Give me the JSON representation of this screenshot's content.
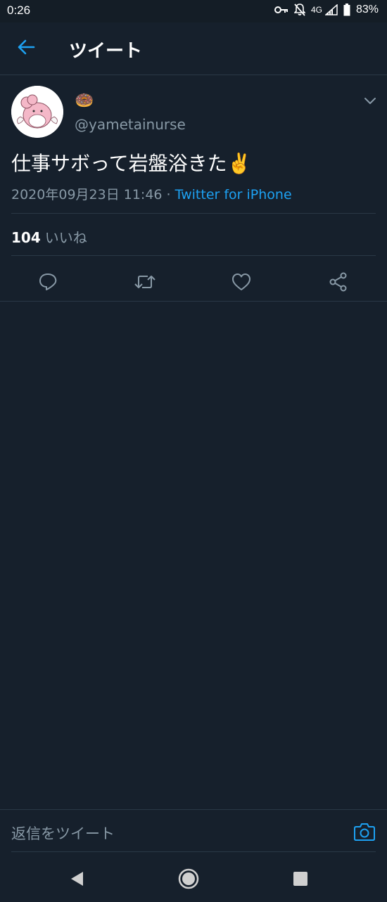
{
  "status_bar": {
    "time": "0:26",
    "network": "4G",
    "battery": "83%"
  },
  "header": {
    "title": "ツイート"
  },
  "tweet": {
    "display_name": "🍩",
    "handle": "@yametainurse",
    "text": "仕事サボって岩盤浴きた✌️",
    "timestamp": "2020年09月23日 11:46",
    "separator": " · ",
    "source": "Twitter for iPhone",
    "likes_count": "104",
    "likes_label": "いいね"
  },
  "reply": {
    "placeholder": "返信をツイート"
  },
  "colors": {
    "background": "#16202c",
    "accent": "#1da1f2",
    "secondary_text": "#8899a6",
    "divider": "#2a3846"
  },
  "icons": {
    "back": "arrow-left-icon",
    "caret": "chevron-down-icon",
    "reply": "reply-icon",
    "retweet": "retweet-icon",
    "like": "heart-icon",
    "share": "share-icon",
    "camera": "camera-icon"
  }
}
